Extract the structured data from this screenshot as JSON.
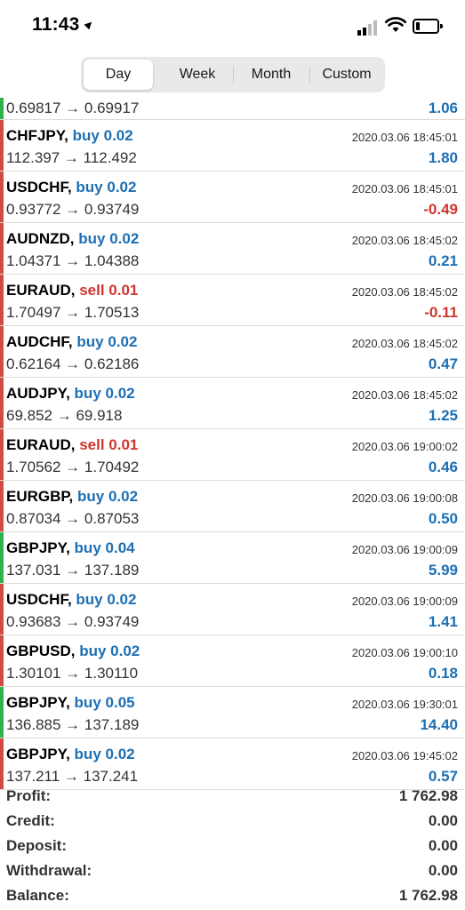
{
  "status_bar": {
    "time": "11:43",
    "location_icon": "location-arrow-icon"
  },
  "segments": {
    "day": "Day",
    "week": "Week",
    "month": "Month",
    "custom": "Custom",
    "active": "Day"
  },
  "colors": {
    "buy": "#1d6fb3",
    "sell": "#d0342c",
    "profit_bar": "#2fb24a",
    "loss_bar": "#d24b43"
  },
  "deals": [
    {
      "symbol": "",
      "side": "",
      "volume": "",
      "prices": "0.69817 → 0.69917",
      "datetime": "",
      "profit": "1.06",
      "side_class": "buy",
      "pl_class": "pos",
      "bar": "#2fb24a"
    },
    {
      "symbol": "CHFJPY,",
      "side": "buy",
      "volume": "0.02",
      "prices": "112.397 → 112.492",
      "datetime": "2020.03.06 18:45:01",
      "profit": "1.80",
      "side_class": "buy",
      "pl_class": "pos",
      "bar": "#d24b43"
    },
    {
      "symbol": "USDCHF,",
      "side": "buy",
      "volume": "0.02",
      "prices": "0.93772 → 0.93749",
      "datetime": "2020.03.06 18:45:01",
      "profit": "-0.49",
      "side_class": "buy",
      "pl_class": "neg",
      "bar": "#d24b43"
    },
    {
      "symbol": "AUDNZD,",
      "side": "buy",
      "volume": "0.02",
      "prices": "1.04371 → 1.04388",
      "datetime": "2020.03.06 18:45:02",
      "profit": "0.21",
      "side_class": "buy",
      "pl_class": "pos",
      "bar": "#d24b43"
    },
    {
      "symbol": "EURAUD,",
      "side": "sell",
      "volume": "0.01",
      "prices": "1.70497 → 1.70513",
      "datetime": "2020.03.06 18:45:02",
      "profit": "-0.11",
      "side_class": "sell",
      "pl_class": "neg",
      "bar": "#d24b43"
    },
    {
      "symbol": "AUDCHF,",
      "side": "buy",
      "volume": "0.02",
      "prices": "0.62164 → 0.62186",
      "datetime": "2020.03.06 18:45:02",
      "profit": "0.47",
      "side_class": "buy",
      "pl_class": "pos",
      "bar": "#d24b43"
    },
    {
      "symbol": "AUDJPY,",
      "side": "buy",
      "volume": "0.02",
      "prices": "69.852 → 69.918",
      "datetime": "2020.03.06 18:45:02",
      "profit": "1.25",
      "side_class": "buy",
      "pl_class": "pos",
      "bar": "#d24b43"
    },
    {
      "symbol": "EURAUD,",
      "side": "sell",
      "volume": "0.01",
      "prices": "1.70562 → 1.70492",
      "datetime": "2020.03.06 19:00:02",
      "profit": "0.46",
      "side_class": "sell",
      "pl_class": "pos",
      "bar": "#d24b43"
    },
    {
      "symbol": "EURGBP,",
      "side": "buy",
      "volume": "0.02",
      "prices": "0.87034 → 0.87053",
      "datetime": "2020.03.06 19:00:08",
      "profit": "0.50",
      "side_class": "buy",
      "pl_class": "pos",
      "bar": "#d24b43"
    },
    {
      "symbol": "GBPJPY,",
      "side": "buy",
      "volume": "0.04",
      "prices": "137.031 → 137.189",
      "datetime": "2020.03.06 19:00:09",
      "profit": "5.99",
      "side_class": "buy",
      "pl_class": "pos",
      "bar": "#2fb24a"
    },
    {
      "symbol": "USDCHF,",
      "side": "buy",
      "volume": "0.02",
      "prices": "0.93683 → 0.93749",
      "datetime": "2020.03.06 19:00:09",
      "profit": "1.41",
      "side_class": "buy",
      "pl_class": "pos",
      "bar": "#d24b43"
    },
    {
      "symbol": "GBPUSD,",
      "side": "buy",
      "volume": "0.02",
      "prices": "1.30101 → 1.30110",
      "datetime": "2020.03.06 19:00:10",
      "profit": "0.18",
      "side_class": "buy",
      "pl_class": "pos",
      "bar": "#d24b43"
    },
    {
      "symbol": "GBPJPY,",
      "side": "buy",
      "volume": "0.05",
      "prices": "136.885 → 137.189",
      "datetime": "2020.03.06 19:30:01",
      "profit": "14.40",
      "side_class": "buy",
      "pl_class": "pos",
      "bar": "#2fb24a"
    },
    {
      "symbol": "GBPJPY,",
      "side": "buy",
      "volume": "0.02",
      "prices": "137.211 → 137.241",
      "datetime": "2020.03.06 19:45:02",
      "profit": "0.57",
      "side_class": "buy",
      "pl_class": "pos",
      "bar": "#d24b43"
    }
  ],
  "summary": [
    {
      "label": "Profit:",
      "value": "1 762.98"
    },
    {
      "label": "Credit:",
      "value": "0.00"
    },
    {
      "label": "Deposit:",
      "value": "0.00"
    },
    {
      "label": "Withdrawal:",
      "value": "0.00"
    },
    {
      "label": "Balance:",
      "value": "1 762.98"
    }
  ]
}
